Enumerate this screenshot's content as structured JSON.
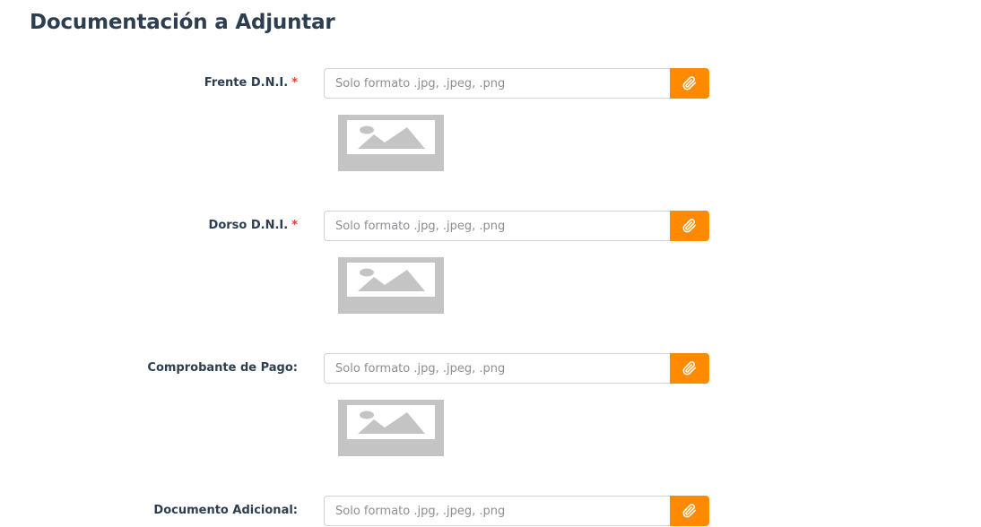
{
  "page": {
    "title": "Documentación a Adjuntar"
  },
  "fields": [
    {
      "label": "Frente D.N.I.",
      "required_mark": "*",
      "placeholder": "Solo formato .jpg, .jpeg, .png",
      "button_icon": "paperclip-icon",
      "preview_icon": "image-placeholder-icon"
    },
    {
      "label": "Dorso D.N.I.",
      "required_mark": "*",
      "placeholder": "Solo formato .jpg, .jpeg, .png",
      "button_icon": "paperclip-icon",
      "preview_icon": "image-placeholder-icon"
    },
    {
      "label": "Comprobante de Pago:",
      "required_mark": "",
      "placeholder": "Solo formato .jpg, .jpeg, .png",
      "button_icon": "paperclip-icon",
      "preview_icon": "image-placeholder-icon"
    },
    {
      "label": "Documento Adicional:",
      "required_mark": "",
      "placeholder": "Solo formato .jpg, .jpeg, .png",
      "button_icon": "paperclip-icon"
    }
  ],
  "colors": {
    "accent": "#ff8a00",
    "required": "#e53935",
    "label_text": "#2c3e50",
    "preview_bg": "#c4c4c4"
  }
}
